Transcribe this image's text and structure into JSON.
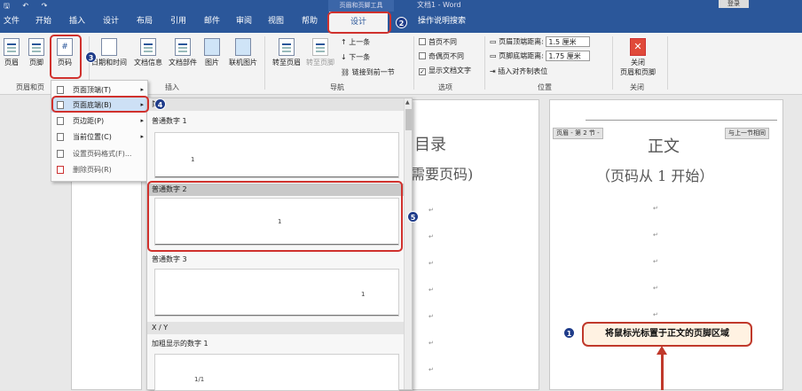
{
  "titlebar": {
    "quick_access": "🖫 ↶ ↷",
    "context_tool": "页眉和页脚工具",
    "doc_title": "文档1 - Word",
    "login": "登录"
  },
  "tabs": {
    "file": "文件",
    "home": "开始",
    "insert": "插入",
    "design_layout": "设计",
    "layout": "布局",
    "references": "引用",
    "mailings": "邮件",
    "review": "审阅",
    "view": "视图",
    "help": "帮助",
    "design": "设计",
    "tell_me": "操作说明搜索"
  },
  "ribbon": {
    "header": "页眉",
    "footer": "页脚",
    "page_number": "页码",
    "group_header_footer": "页眉和页",
    "date_time": "日期和时间",
    "doc_info": "文档信息",
    "doc_parts": "文档部件",
    "picture": "图片",
    "online_picture": "联机图片",
    "group_insert": "插入",
    "goto_header": "转至页眉",
    "goto_footer": "转至页脚",
    "prev": "上一条",
    "next": "下一条",
    "link_prev": "链接到前一节",
    "group_nav": "导航",
    "diff_first": "首页不同",
    "diff_odd_even": "奇偶页不同",
    "show_doc_text": "显示文档文字",
    "group_options": "选项",
    "header_top_label": "页眉顶端距离:",
    "header_top_value": "1.5 厘米",
    "footer_bottom_label": "页脚底端距离:",
    "footer_bottom_value": "1.75 厘米",
    "insert_align_tab": "插入对齐制表位",
    "group_position": "位置",
    "close_l1": "关闭",
    "close_l2": "页眉和页脚",
    "group_close": "关闭"
  },
  "menu": {
    "items": [
      {
        "label": "页面顶端(T)",
        "arrow": "▸"
      },
      {
        "label": "页面底端(B)",
        "arrow": "▸"
      },
      {
        "label": "页边距(P)",
        "arrow": "▸"
      },
      {
        "label": "当前位置(C)",
        "arrow": "▸"
      },
      {
        "label": "设置页码格式(F)...",
        "arrow": ""
      },
      {
        "label": "删除页码(R)",
        "arrow": ""
      }
    ]
  },
  "gallery": {
    "header": "简单",
    "items": [
      "普通数字 1",
      "普通数字 2",
      "普通数字 3"
    ],
    "section_xy": "X / Y",
    "bold_item": "加粗显示的数字 1",
    "thumb_mark": "1",
    "bold_mark": "1/1"
  },
  "doc": {
    "toc_title": "目录",
    "toc_sub": "需要页码)",
    "body_title": "正文",
    "body_sub": "（页码从 1 开始）",
    "footer_tag": "页眉 - 第 2 节 -",
    "same_as_prev": "与上一节相同",
    "para_mark": "↵"
  },
  "annotations": {
    "step1": "1",
    "step2": "2",
    "step3": "3",
    "step4": "4",
    "step5": "5",
    "callout": "将鼠标光标置于正文的页脚区域"
  },
  "colors": {
    "word_blue": "#2b579a",
    "annotation_red": "#d0312d",
    "step_circle": "#1f3c8a"
  }
}
